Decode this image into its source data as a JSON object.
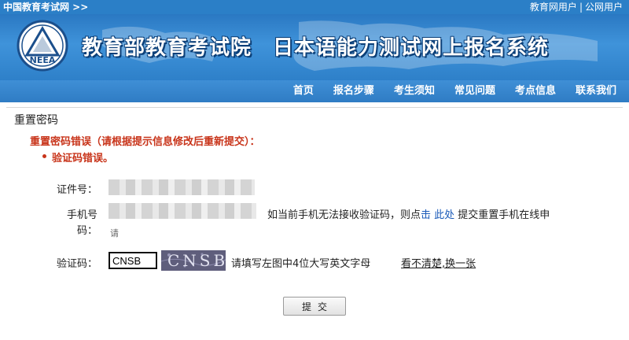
{
  "topbar": {
    "site_name": "中国教育考试网 >>",
    "user_link_1": "教育网用户",
    "separator": "|",
    "user_link_2": "公网用户"
  },
  "banner": {
    "logo_text": "NEEA",
    "title": "教育部教育考试院　日本语能力测试网上报名系统"
  },
  "nav": {
    "items": [
      "首页",
      "报名步骤",
      "考生须知",
      "常见问题",
      "考点信息",
      "联系我们"
    ]
  },
  "page_title": "重置密码",
  "error": {
    "title": "重置密码错误（请根据提示信息修改后重新提交）：",
    "items": [
      "验证码错误。"
    ]
  },
  "form": {
    "id_label": "证件号：",
    "phone_label": "手机号码：",
    "phone_hint_prefix": "如当前手机无法接收验证码，则点",
    "phone_hint_link": "击 此处",
    "phone_hint_suffix": " 提交重置手机在线申",
    "phone_hint_wrap": "请",
    "captcha_label": "验证码：",
    "captcha_value": "CNSB",
    "captcha_image_text": "CNSB",
    "captcha_hint": "请填写左图中4位大写英文字母",
    "captcha_refresh": "看不清楚,换一张",
    "submit_label": "提交"
  },
  "colors": {
    "topbar": "#2b7fc7",
    "nav": "#2f7cc4",
    "error": "#c8341a",
    "link": "#1a5ab8"
  }
}
